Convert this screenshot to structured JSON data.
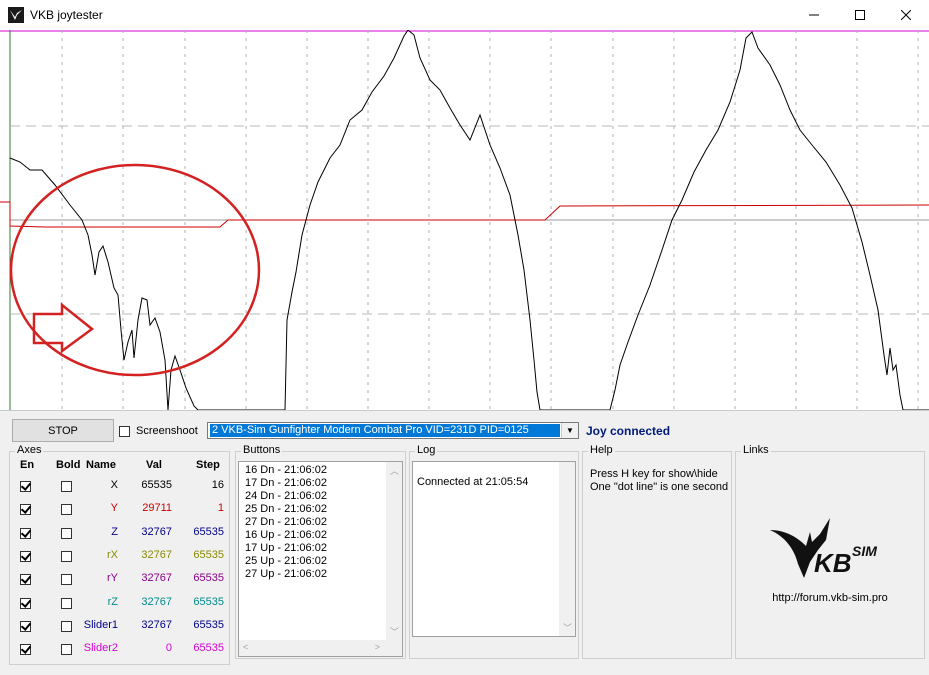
{
  "window": {
    "title": "VKB joytester",
    "icons": {
      "app": "vkb-app-icon",
      "minimize": "minimize-icon",
      "maximize": "maximize-icon",
      "close": "close-icon"
    }
  },
  "plot": {
    "colors": {
      "magenta": "#d400d4",
      "red": "#cc0000",
      "black": "#000000",
      "grid": "#b0b0b0",
      "annotation": "#d42222"
    }
  },
  "controls": {
    "stop_label": "STOP",
    "screenshot_label": "Screenshoot",
    "screenshot_checked": false,
    "device_selected": "2  VKB-Sim Gunfighter Modern Combat Pro  VID=231D PID=0125",
    "status": "Joy connected"
  },
  "axes": {
    "title": "Axes",
    "headers": {
      "en": "En",
      "bold": "Bold",
      "name": "Name",
      "val": "Val",
      "step": "Step"
    },
    "rows": [
      {
        "en": true,
        "bold": false,
        "name": "X",
        "val": "65535",
        "step": "16",
        "color": "#000000"
      },
      {
        "en": true,
        "bold": false,
        "name": "Y",
        "val": "29711",
        "step": "1",
        "color": "#cc0000"
      },
      {
        "en": true,
        "bold": false,
        "name": "Z",
        "val": "32767",
        "step": "65535",
        "color": "#00008b"
      },
      {
        "en": true,
        "bold": false,
        "name": "rX",
        "val": "32767",
        "step": "65535",
        "color": "#8a8a00"
      },
      {
        "en": true,
        "bold": false,
        "name": "rY",
        "val": "32767",
        "step": "65535",
        "color": "#8b008b"
      },
      {
        "en": true,
        "bold": false,
        "name": "rZ",
        "val": "32767",
        "step": "65535",
        "color": "#008b8b"
      },
      {
        "en": true,
        "bold": false,
        "name": "Slider1",
        "val": "32767",
        "step": "65535",
        "color": "#00008b"
      },
      {
        "en": true,
        "bold": false,
        "name": "Slider2",
        "val": "0",
        "step": "65535",
        "color": "#d400d4"
      }
    ]
  },
  "buttons_group": {
    "title": "Buttons",
    "items": [
      "16 Dn - 21:06:02",
      "17 Dn - 21:06:02",
      "24 Dn - 21:06:02",
      "25 Dn - 21:06:02",
      "27 Dn - 21:06:02",
      "16 Up - 21:06:02",
      "17 Up - 21:06:02",
      "25 Up - 21:06:02",
      "27 Up - 21:06:02"
    ]
  },
  "log_group": {
    "title": "Log",
    "text": "Connected at 21:05:54"
  },
  "help_group": {
    "title": "Help",
    "lines": [
      "Press H key for show\\hide",
      "One \"dot line\" is one second"
    ]
  },
  "links_group": {
    "title": "Links",
    "logo_text": "KB",
    "logo_sub": "SIM",
    "url": "http://forum.vkb-sim.pro"
  }
}
